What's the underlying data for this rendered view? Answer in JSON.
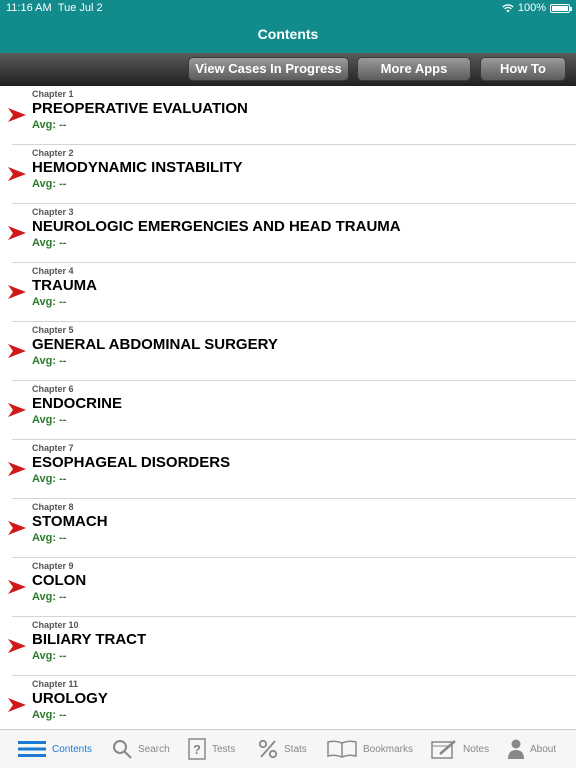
{
  "status_bar": {
    "time": "11:16 AM",
    "date": "Tue Jul 2",
    "battery": "100%"
  },
  "nav": {
    "title": "Contents"
  },
  "toolbar": {
    "view_cases": "View Cases In Progress",
    "more_apps": "More Apps",
    "how_to": "How To"
  },
  "chapters": [
    {
      "label": "Chapter 1",
      "title": "PREOPERATIVE EVALUATION",
      "avg": "Avg: --"
    },
    {
      "label": "Chapter 2",
      "title": "HEMODYNAMIC INSTABILITY",
      "avg": "Avg: --"
    },
    {
      "label": "Chapter 3",
      "title": "NEUROLOGIC EMERGENCIES AND HEAD TRAUMA",
      "avg": "Avg: --"
    },
    {
      "label": "Chapter 4",
      "title": "TRAUMA",
      "avg": "Avg: --"
    },
    {
      "label": "Chapter 5",
      "title": "GENERAL ABDOMINAL SURGERY",
      "avg": "Avg: --"
    },
    {
      "label": "Chapter 6",
      "title": "ENDOCRINE",
      "avg": "Avg: --"
    },
    {
      "label": "Chapter 7",
      "title": "ESOPHAGEAL DISORDERS",
      "avg": "Avg: --"
    },
    {
      "label": "Chapter 8",
      "title": "STOMACH",
      "avg": "Avg: --"
    },
    {
      "label": "Chapter 9",
      "title": "COLON",
      "avg": "Avg: --"
    },
    {
      "label": "Chapter 10",
      "title": "BILIARY TRACT",
      "avg": "Avg: --"
    },
    {
      "label": "Chapter 11",
      "title": "UROLOGY",
      "avg": "Avg: --"
    }
  ],
  "tabs": {
    "contents": "Contents",
    "search": "Search",
    "tests": "Tests",
    "stats": "Stats",
    "bookmarks": "Bookmarks",
    "notes": "Notes",
    "about": "About"
  },
  "colors": {
    "nav": "#128b8c",
    "arrow": "#d01a1a",
    "avg": "#2c7a2c",
    "active_tab": "#1a7ad4"
  }
}
